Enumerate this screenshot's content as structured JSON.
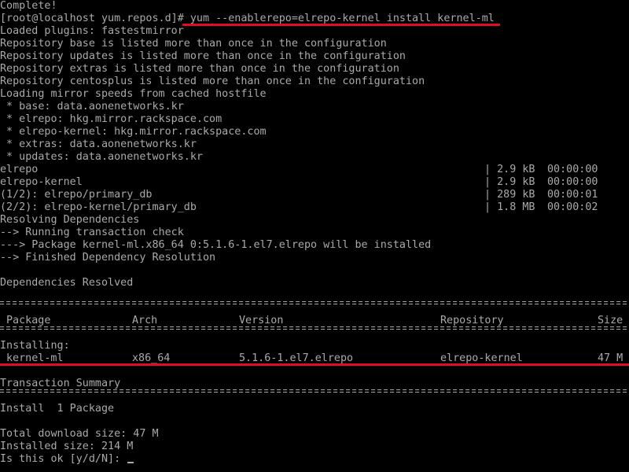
{
  "terminal": {
    "lines": [
      "Complete!",
      "[root@localhost yum.repos.d]# yum --enablerepo=elrepo-kernel install kernel-ml",
      "Loaded plugins: fastestmirror",
      "Repository base is listed more than once in the configuration",
      "Repository updates is listed more than once in the configuration",
      "Repository extras is listed more than once in the configuration",
      "Repository centosplus is listed more than once in the configuration",
      "Loading mirror speeds from cached hostfile",
      " * base: data.aonenetworks.kr",
      " * elrepo: hkg.mirror.rackspace.com",
      " * elrepo-kernel: hkg.mirror.rackspace.com",
      " * extras: data.aonenetworks.kr",
      " * updates: data.aonenetworks.kr"
    ],
    "downloads": [
      {
        "name": "elrepo",
        "size": "| 2.9 kB",
        "time": "00:00:00"
      },
      {
        "name": "elrepo-kernel",
        "size": "| 2.9 kB",
        "time": "00:00:00"
      },
      {
        "name": "(1/2): elrepo/primary_db",
        "size": "| 289 kB",
        "time": "00:00:01"
      },
      {
        "name": "(2/2): elrepo-kernel/primary_db",
        "size": "| 1.8 MB",
        "time": "00:00:02"
      }
    ],
    "resolve_lines": [
      "Resolving Dependencies",
      "--> Running transaction check",
      "---> Package kernel-ml.x86_64 0:5.1.6-1.el7.elrepo will be installed",
      "--> Finished Dependency Resolution"
    ],
    "deps_resolved": "Dependencies Resolved",
    "table": {
      "headers": {
        "package": "Package",
        "arch": "Arch",
        "version": "Version",
        "repository": "Repository",
        "size": "Size"
      },
      "section": "Installing:",
      "row": {
        "package": "kernel-ml",
        "arch": "x86_64",
        "version": "5.1.6-1.el7.elrepo",
        "repository": "elrepo-kernel",
        "size": "47 M"
      }
    },
    "summary": {
      "title": "Transaction Summary",
      "install": "Install  1 Package",
      "download_size": "Total download size: 47 M",
      "installed_size": "Installed size: 214 M",
      "prompt": "Is this ok [y/d/N]: "
    },
    "colors": {
      "background": "#000000",
      "text": "#aaaaaa",
      "highlight": "#dc0f1e"
    }
  }
}
